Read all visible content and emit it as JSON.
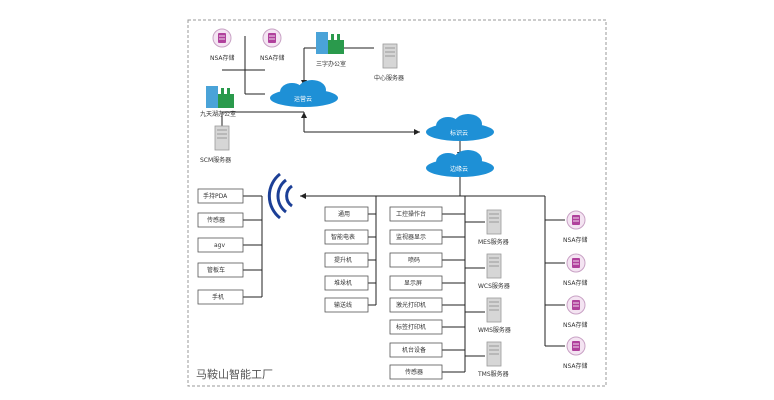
{
  "footer_label": "马鞍山智能工厂",
  "clouds": {
    "top": "运营云",
    "right_upper": "标识云",
    "right_lower": "边缘云"
  },
  "nsa_label": "NSA存储",
  "office_sanfang": "三字办公室",
  "office_jiuyuan": "九天湖办公室",
  "center_server": "中心服务器",
  "scm_server": "SCM服务器",
  "devices_left": [
    "手持PDA",
    "传感器",
    "agv",
    "管板车",
    "手机"
  ],
  "devices_mid": [
    "通用",
    "智能电表",
    "提升机",
    "堆垛机",
    "输送线"
  ],
  "devices_mid2": [
    "工控操作台",
    "监视器显示",
    "喷码",
    "显示屏",
    "激光打印机",
    "标签打印机",
    "机台设备",
    "传感器"
  ],
  "servers_mid": [
    "MES服务器",
    "WCS服务器",
    "WMS服务器",
    "TMS服务器"
  ],
  "colors": {
    "cloud": "#1e90d6",
    "nsa": "#b0419c",
    "building": "#2a9a4c",
    "wifi": "#1c3f96",
    "line": "#222222",
    "frame": "#999999"
  }
}
